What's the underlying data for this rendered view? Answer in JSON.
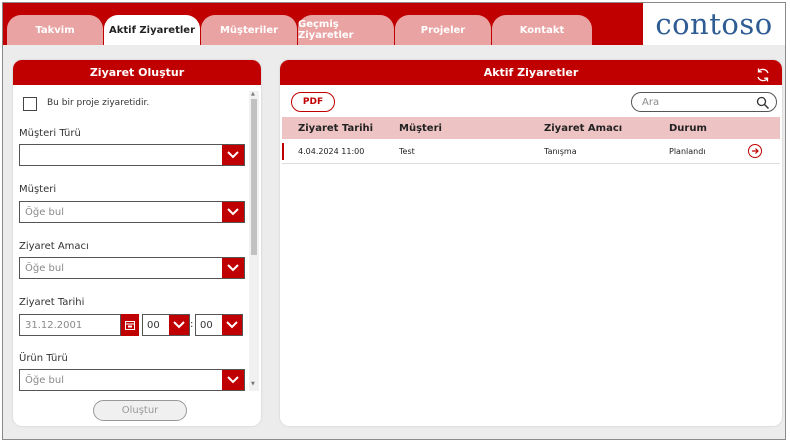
{
  "nav": {
    "tabs": [
      {
        "label": "Takvim",
        "active": false
      },
      {
        "label": "Aktif Ziyaretler",
        "active": true
      },
      {
        "label": "Müşteriler",
        "active": false
      },
      {
        "label": "Geçmiş Ziyaretler",
        "active": false
      },
      {
        "label": "Projeler",
        "active": false
      },
      {
        "label": "Kontakt",
        "active": false
      }
    ],
    "logo": "contoso"
  },
  "create_panel": {
    "title": "Ziyaret Oluştur",
    "project_checkbox_label": "Bu bir proje ziyaretidir.",
    "customer_type": {
      "label": "Müşteri Türü",
      "value": ""
    },
    "customer": {
      "label": "Müşteri",
      "placeholder": "Öğe bul"
    },
    "purpose": {
      "label": "Ziyaret Amacı",
      "placeholder": "Öğe bul"
    },
    "visit_date": {
      "label": "Ziyaret Tarihi",
      "placeholder": "31.12.2001",
      "hour": "00",
      "minute": "00"
    },
    "product_type": {
      "label": "Ürün Türü",
      "placeholder": "Öğe bul"
    },
    "create_button": "Oluştur"
  },
  "active_panel": {
    "title": "Aktif Ziyaretler",
    "pdf_button": "PDF",
    "search_placeholder": "Ara",
    "columns": [
      "Ziyaret Tarihi",
      "Müşteri",
      "Ziyaret Amacı",
      "Durum"
    ],
    "rows": [
      {
        "date": "4.04.2024 11:00",
        "customer": "Test",
        "purpose": "Tanışma",
        "status": "Planlandı"
      }
    ]
  },
  "colors": {
    "accent": "#c00000",
    "tab_inactive": "#e9a3a3",
    "table_header": "#eec3c3",
    "logo": "#2e5c93"
  }
}
